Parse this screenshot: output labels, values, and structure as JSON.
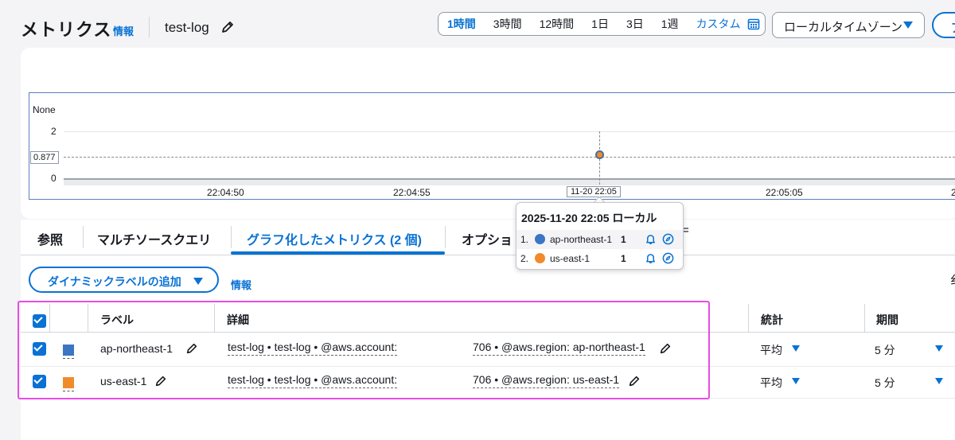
{
  "header": {
    "title": "メトリクス",
    "info": "情報",
    "metric_name": "test-log",
    "time_ranges": [
      "1時間",
      "3時間",
      "12時間",
      "1日",
      "3日",
      "1週"
    ],
    "custom": "カスタム",
    "timezone": "ローカルタイムゾーン",
    "right_button_partial": "ア"
  },
  "graph": {
    "y_unit": "None",
    "y_ticks": [
      "2",
      "0"
    ],
    "y_readout": "0.877",
    "x_ticks": [
      "22:04:50",
      "22:04:55",
      "22:05:05",
      "2"
    ],
    "x_readout": "11-20 22:05"
  },
  "tooltip": {
    "title": "2025-11-20 22:05 ローカル",
    "rows": [
      {
        "num": "1.",
        "name": "ap-northeast-1",
        "value": "1",
        "color": "#3b75c4"
      },
      {
        "num": "2.",
        "name": "us-east-1",
        "value": "1",
        "color": "#f08b2c"
      }
    ]
  },
  "tabs": {
    "items": [
      "参照",
      "マルチソースクエリ",
      "グラフ化したメトリクス (2 個)",
      "オプショ"
    ],
    "overflow": "="
  },
  "toolbar": {
    "dynamic_label": "ダイナミックラベルの追加",
    "info": "情報",
    "right_partial": "纟"
  },
  "table": {
    "headers": {
      "label": "ラベル",
      "details": "詳細",
      "stat": "統計",
      "period": "期間"
    },
    "rows": [
      {
        "label": "ap-northeast-1",
        "color": "#3b75c4",
        "details_left": "test-log • test-log • @aws.account:",
        "details_right": "706 • @aws.region: ap-northeast-1",
        "stat": "平均",
        "period": "5 分"
      },
      {
        "label": "us-east-1",
        "color": "#f08b2c",
        "details_left": "test-log • test-log • @aws.account:",
        "details_right": "706 • @aws.region: us-east-1",
        "stat": "平均",
        "period": "5 分"
      }
    ]
  }
}
